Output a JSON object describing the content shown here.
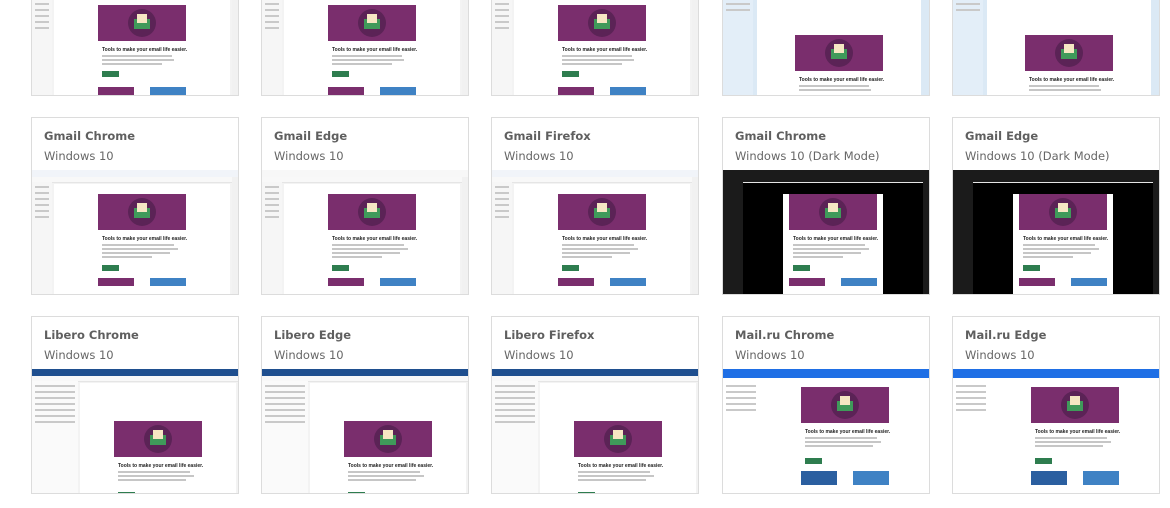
{
  "email_preview": {
    "headline": "Tools to make your email life easier."
  },
  "row1": [
    {
      "title": "",
      "sub": ""
    },
    {
      "title": "",
      "sub": ""
    },
    {
      "title": "",
      "sub": ""
    },
    {
      "title": "",
      "sub": ""
    },
    {
      "title": "",
      "sub": ""
    }
  ],
  "row2": [
    {
      "title": "Gmail Chrome",
      "sub": "Windows 10"
    },
    {
      "title": "Gmail Edge",
      "sub": "Windows 10"
    },
    {
      "title": "Gmail Firefox",
      "sub": "Windows 10"
    },
    {
      "title": "Gmail Chrome",
      "sub": "Windows 10 (Dark Mode)"
    },
    {
      "title": "Gmail Edge",
      "sub": "Windows 10 (Dark Mode)"
    }
  ],
  "row3": [
    {
      "title": "Libero Chrome",
      "sub": "Windows 10"
    },
    {
      "title": "Libero Edge",
      "sub": "Windows 10"
    },
    {
      "title": "Libero Firefox",
      "sub": "Windows 10"
    },
    {
      "title": "Mail.ru Chrome",
      "sub": "Windows 10"
    },
    {
      "title": "Mail.ru Edge",
      "sub": "Windows 10"
    }
  ],
  "colors": {
    "hero": "#7a2e6d",
    "button_green": "#2e7d4f",
    "libero_bar": "#1f4f8f",
    "mailru_bar": "#1f6fe5"
  }
}
